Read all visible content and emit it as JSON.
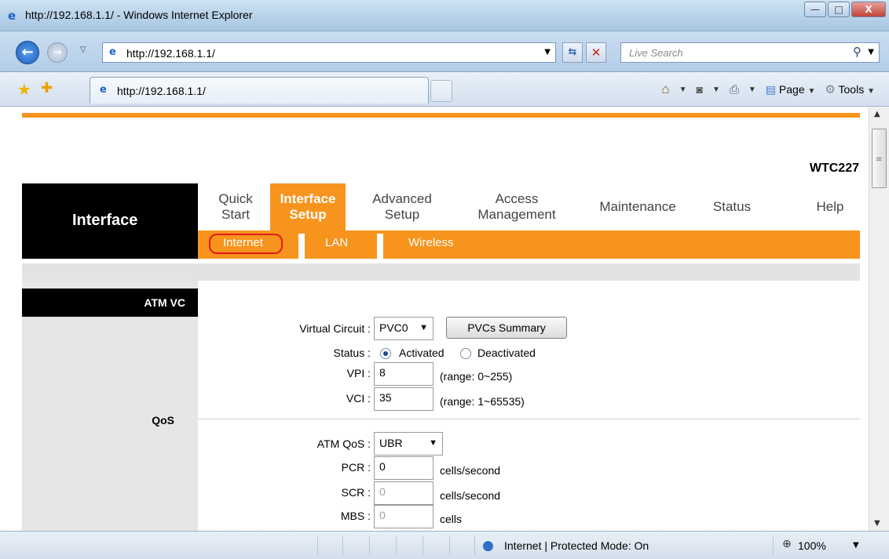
{
  "window": {
    "title": "http://192.168.1.1/ - Windows Internet Explorer",
    "buttons": {
      "minimize": "—",
      "maximize": "□",
      "close": "X"
    }
  },
  "address_bar": {
    "url": "http://192.168.1.1/",
    "search_placeholder": "Live Search"
  },
  "command_bar": {
    "tab_title": "http://192.168.1.1/",
    "page_label": "Page",
    "tools_label": "Tools"
  },
  "router": {
    "model": "WTC227",
    "section_title": "Interface",
    "nav": [
      {
        "label": "Quick\nStart",
        "active": false
      },
      {
        "label": "Interface\nSetup",
        "active": true
      },
      {
        "label": "Advanced\nSetup",
        "active": false
      },
      {
        "label": "Access\nManagement",
        "active": false
      },
      {
        "label": "Maintenance",
        "active": false
      },
      {
        "label": "Status",
        "active": false
      },
      {
        "label": "Help",
        "active": false
      }
    ],
    "subnav": [
      "Internet",
      "LAN",
      "Wireless"
    ],
    "left_labels": {
      "atm_vc": "ATM VC",
      "qos": "QoS"
    },
    "form": {
      "virtual_circuit_label": "Virtual Circuit :",
      "virtual_circuit_value": "PVC0",
      "pvcs_summary_button": "PVCs Summary",
      "status_label": "Status :",
      "status_activated": "Activated",
      "status_deactivated": "Deactivated",
      "vpi_label": "VPI :",
      "vpi_value": "8",
      "vpi_range": "(range: 0~255)",
      "vci_label": "VCI :",
      "vci_value": "35",
      "vci_range": "(range: 1~65535)",
      "atm_qos_label": "ATM QoS :",
      "atm_qos_value": "UBR",
      "pcr_label": "PCR :",
      "pcr_value": "0",
      "pcr_unit": "cells/second",
      "scr_label": "SCR :",
      "scr_value": "0",
      "scr_unit": "cells/second",
      "mbs_label": "MBS :",
      "mbs_value": "0",
      "mbs_unit": "cells"
    }
  },
  "status_bar": {
    "zone": "Internet | Protected Mode: On",
    "zoom": "100%"
  }
}
